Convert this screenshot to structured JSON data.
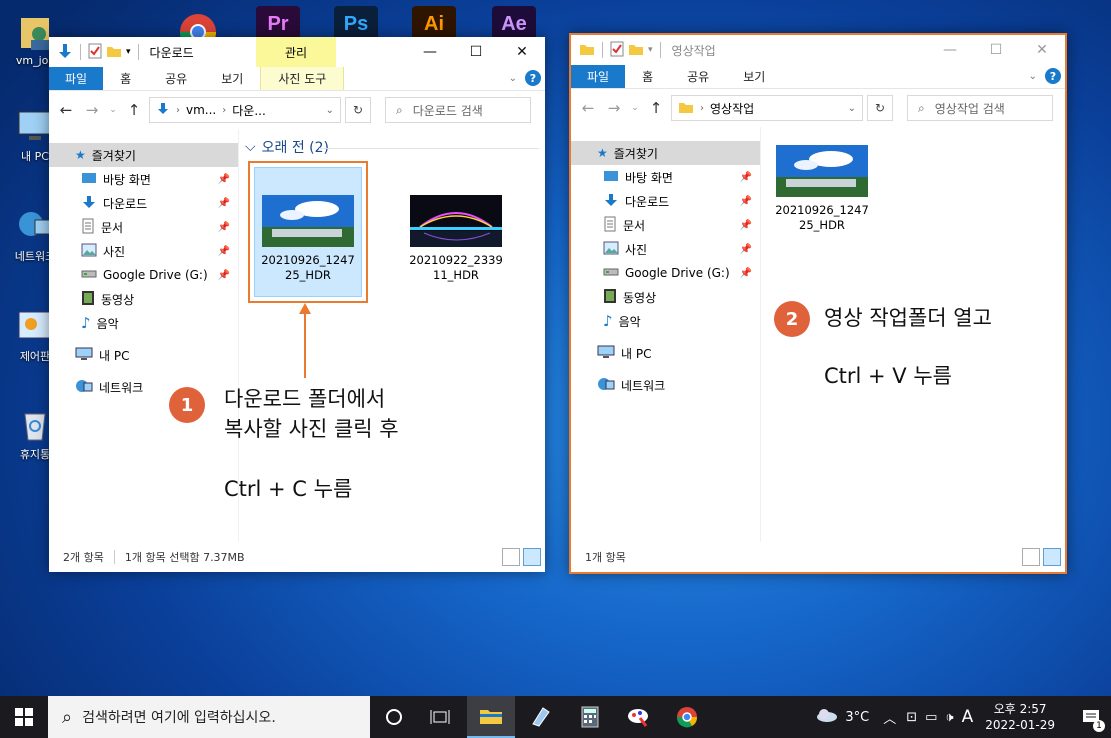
{
  "desktop": {
    "icons": [
      {
        "label": "vm_jos"
      },
      {
        "label": "내 PC"
      },
      {
        "label": "네트워크"
      },
      {
        "label": "제어판"
      },
      {
        "label": "휴지통"
      }
    ],
    "top_apps": [
      {
        "name": "Pr",
        "color": "#2a0a38",
        "fg": "#e77cf9"
      },
      {
        "name": "Ps",
        "color": "#0a1f3a",
        "fg": "#31a8ff"
      },
      {
        "name": "Ai",
        "color": "#2f1500",
        "fg": "#ff9a00"
      },
      {
        "name": "Ae",
        "color": "#1d0c3a",
        "fg": "#cf96fd"
      }
    ]
  },
  "win1": {
    "title": "다운로드",
    "context_tab": "관리",
    "tabs": [
      "파일",
      "홈",
      "공유",
      "보기",
      "사진 도구"
    ],
    "address": {
      "segments": [
        "vm...",
        "다운..."
      ]
    },
    "search_placeholder": "다운로드 검색",
    "nav": {
      "quick": "즐겨찾기",
      "items": [
        "바탕 화면",
        "다운로드",
        "문서",
        "사진",
        "Google Drive (G:)",
        "동영상",
        "음악"
      ],
      "pc": "내 PC",
      "network": "네트워크"
    },
    "group": "오래 전 (2)",
    "files": [
      {
        "name1": "20210926_1247",
        "name2": "25_HDR"
      },
      {
        "name1": "20210922_2339",
        "name2": "11_HDR"
      }
    ],
    "status": {
      "count": "2개 항목",
      "selected": "1개 항목 선택함 7.37MB"
    }
  },
  "win2": {
    "title": "영상작업",
    "tabs": [
      "파일",
      "홈",
      "공유",
      "보기"
    ],
    "address": {
      "segment": "영상작업"
    },
    "search_placeholder": "영상작업 검색",
    "nav": {
      "quick": "즐겨찾기",
      "items": [
        "바탕 화면",
        "다운로드",
        "문서",
        "사진",
        "Google Drive (G:)",
        "동영상",
        "음악"
      ],
      "pc": "내 PC",
      "network": "네트워크"
    },
    "files": [
      {
        "name1": "20210926_1247",
        "name2": "25_HDR"
      }
    ],
    "status": {
      "count": "1개 항목"
    }
  },
  "callouts": {
    "step1": {
      "num": "1",
      "line1": "다운로드 폴더에서",
      "line2": "복사할 사진 클릭 후",
      "line3": "Ctrl + C 누름"
    },
    "step2": {
      "num": "2",
      "line1": "영상 작업폴더 열고",
      "line2": "Ctrl + V 누름"
    }
  },
  "taskbar": {
    "search_placeholder": "검색하려면 여기에 입력하십시오.",
    "weather": "3°C",
    "ime": "A",
    "time": "오후 2:57",
    "date": "2022-01-29",
    "notif": "1"
  },
  "colors": {
    "accent": "#1979ca",
    "highlight": "#e97a2e",
    "callout": "#e0623a"
  }
}
